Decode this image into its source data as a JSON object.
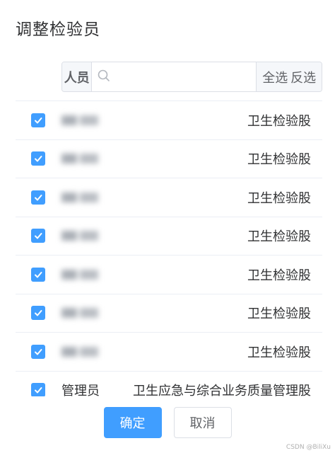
{
  "dialog": {
    "title": "调整检验员"
  },
  "search": {
    "prepend_label": "人员",
    "placeholder": "",
    "value": "",
    "select_all": "全选",
    "invert_select": "反选"
  },
  "rows": [
    {
      "name": "",
      "dept": "卫生检验股",
      "checked": true,
      "blurred": true
    },
    {
      "name": "",
      "dept": "卫生检验股",
      "checked": true,
      "blurred": true
    },
    {
      "name": "",
      "dept": "卫生检验股",
      "checked": true,
      "blurred": true
    },
    {
      "name": "",
      "dept": "卫生检验股",
      "checked": true,
      "blurred": true
    },
    {
      "name": "",
      "dept": "卫生检验股",
      "checked": true,
      "blurred": true
    },
    {
      "name": "",
      "dept": "卫生检验股",
      "checked": true,
      "blurred": true
    },
    {
      "name": "",
      "dept": "卫生检验股",
      "checked": true,
      "blurred": true
    },
    {
      "name": "管理员",
      "dept": "卫生应急与综合业务质量管理股",
      "checked": true,
      "blurred": false
    }
  ],
  "footer": {
    "confirm_label": "确定",
    "cancel_label": "取消"
  },
  "watermark": "CSDN @BiliXu",
  "colors": {
    "primary": "#409eff",
    "border": "#dcdfe6",
    "addon_bg": "#f5f7fa"
  }
}
